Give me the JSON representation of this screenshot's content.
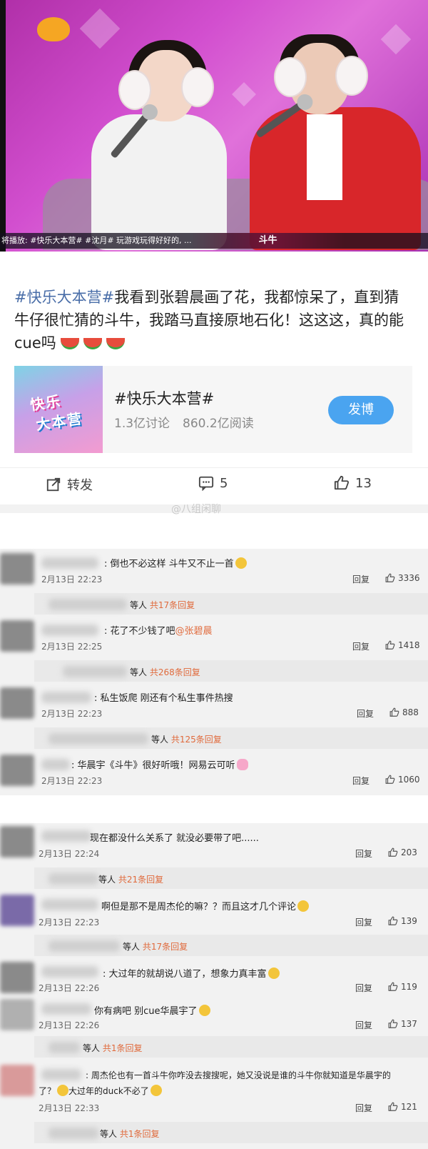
{
  "video": {
    "ticker": "将播放: #快乐大本营# #沈月# 玩游戏玩得好好的, ...",
    "song_tag": "斗牛"
  },
  "post": {
    "hashtag": "#快乐大本营#",
    "text": "我看到张碧晨画了花，我都惊呆了，直到猜牛仔很忙猜的斗牛，我踏马直接原地石化！这这这，真的能 cue吗",
    "topic": {
      "thumb_line1": "快乐",
      "thumb_line2": "大本营",
      "title": "#快乐大本营#",
      "discussions": "1.3亿讨论",
      "reads": "860.2亿阅读",
      "follow_label": "发博"
    },
    "actions": {
      "repost_label": "转发",
      "comment_count": "5",
      "like_count": "13"
    },
    "watermark": "@八组闲聊"
  },
  "comments_a": [
    {
      "text": "倒也不必这样 斗牛又不止一首",
      "time": "2月13日 22:23",
      "reply": "回复",
      "likes": "3336",
      "emoji": "yellow"
    },
    {
      "sub_text": "等人",
      "sub_count": "共17条回复"
    },
    {
      "text": "花了不少钱了吧",
      "at": "@张碧晨",
      "time": "2月13日 22:25",
      "reply": "回复",
      "likes": "1418"
    },
    {
      "sub_text": "等人",
      "sub_count": "共268条回复"
    },
    {
      "text": "私生饭爬 刚还有个私生事件热搜",
      "time": "2月13日 22:23",
      "reply": "回复",
      "likes": "888"
    },
    {
      "sub_text": "等人",
      "sub_count": "共125条回复"
    },
    {
      "text": "华晨宇《斗牛》很好听哦！网易云可听",
      "time": "2月13日 22:23",
      "reply": "回复",
      "likes": "1060",
      "emoji": "pink"
    }
  ],
  "comments_b": [
    {
      "text": "现在都没什么关系了 就没必要带了吧......",
      "time": "2月13日 22:24",
      "reply": "回复",
      "likes": "203"
    },
    {
      "sub_text": "等人",
      "sub_count": "共21条回复"
    },
    {
      "text": "啊但是那不是周杰伦的嘛？？而且这才几个评论",
      "time": "2月13日 22:23",
      "reply": "回复",
      "likes": "139",
      "emoji": "yellow"
    },
    {
      "sub_text": "等人",
      "sub_count": "共17条回复"
    },
    {
      "text": "大过年的就胡说八道了，想象力真丰富",
      "time": "2月13日 22:26",
      "reply": "回复",
      "likes": "119",
      "emoji": "yellow"
    },
    {
      "text": "你有病吧 别cue华晨宇了",
      "time": "2月13日 22:26",
      "reply": "回复",
      "likes": "137",
      "emoji": "yellow"
    },
    {
      "sub_text": "等人",
      "sub_count": "共1条回复"
    },
    {
      "text": "周杰伦也有一首斗牛你咋没去搜搜呢，她又没说是谁的斗牛你就知道是华晨宇的",
      "text2": "了？",
      "text3": "大过年的duck不必了",
      "time": "2月13日 22:33",
      "reply": "回复",
      "likes": "121"
    },
    {
      "sub_text": "等人",
      "sub_count": "共1条回复"
    }
  ]
}
